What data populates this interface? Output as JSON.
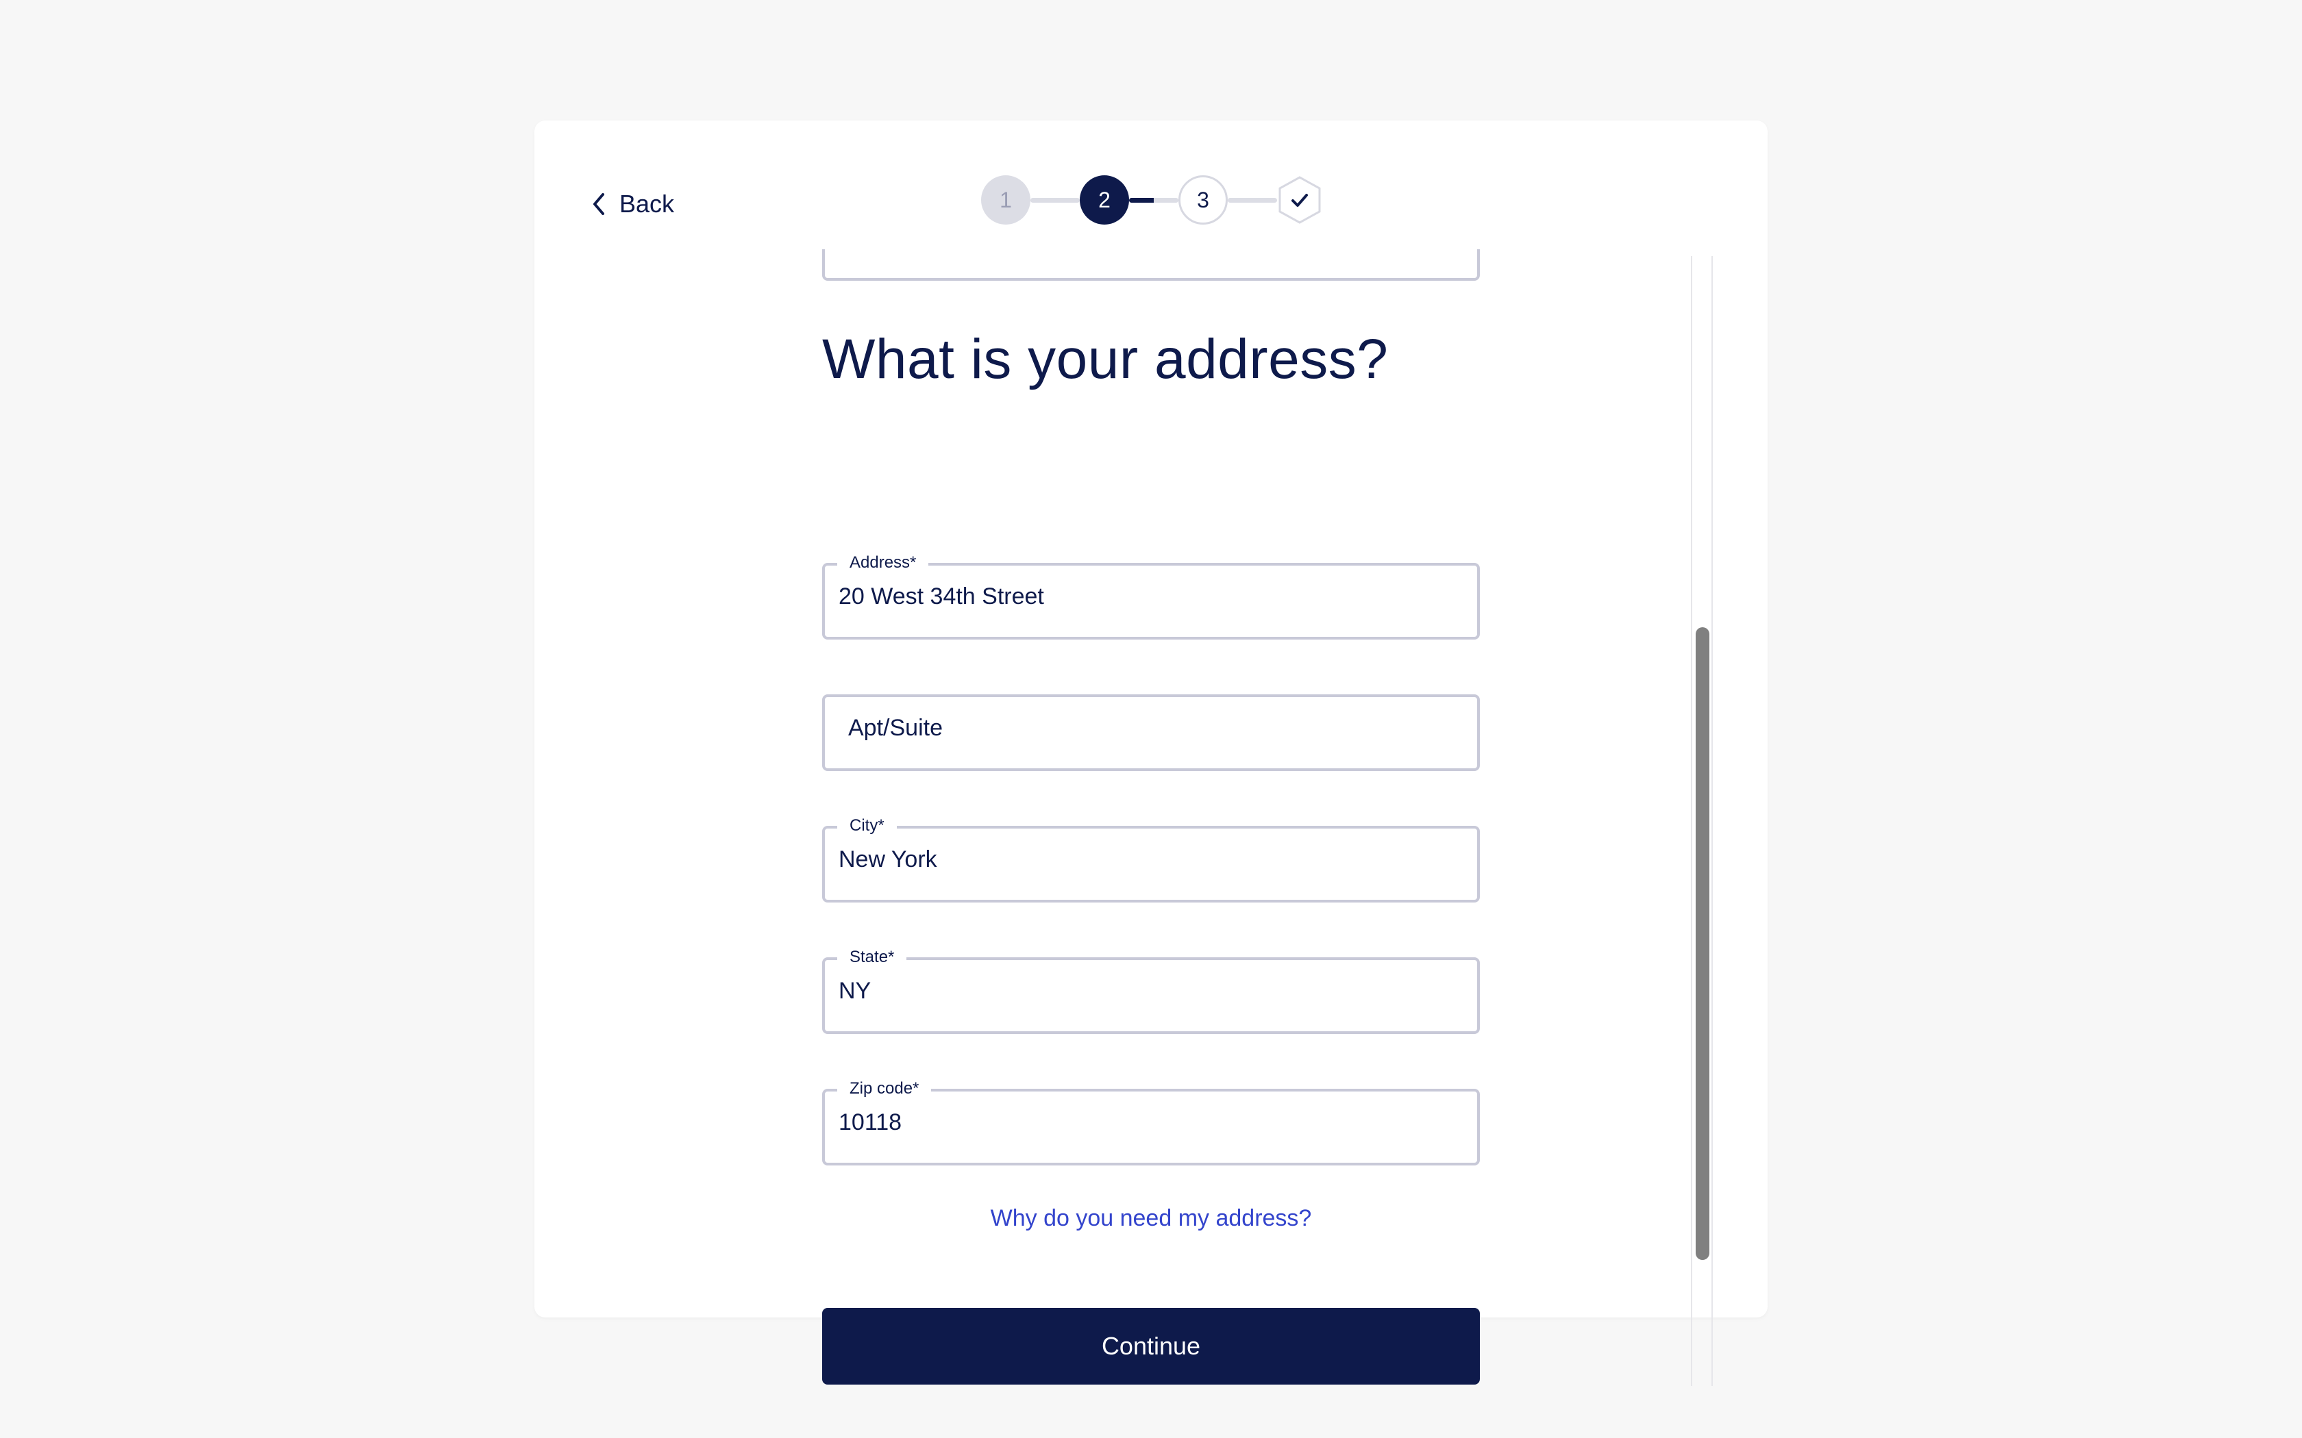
{
  "nav": {
    "back_label": "Back"
  },
  "stepper": {
    "steps": [
      "1",
      "2",
      "3"
    ],
    "current_step": 2,
    "final_icon": "check-icon"
  },
  "form": {
    "title": "What is your address?",
    "address": {
      "label": "Address*",
      "value": "20 West 34th Street"
    },
    "apt": {
      "placeholder": "Apt/Suite",
      "value": ""
    },
    "city": {
      "label": "City*",
      "value": "New York"
    },
    "state": {
      "label": "State*",
      "value": "NY"
    },
    "zip": {
      "label": "Zip code*",
      "value": "10118"
    },
    "help_link": "Why do you need my address?",
    "continue_label": "Continue"
  },
  "colors": {
    "primary": "#0e1a4b",
    "link": "#3344cc",
    "border": "#c8c9d8",
    "background": "#f7f7f7"
  }
}
